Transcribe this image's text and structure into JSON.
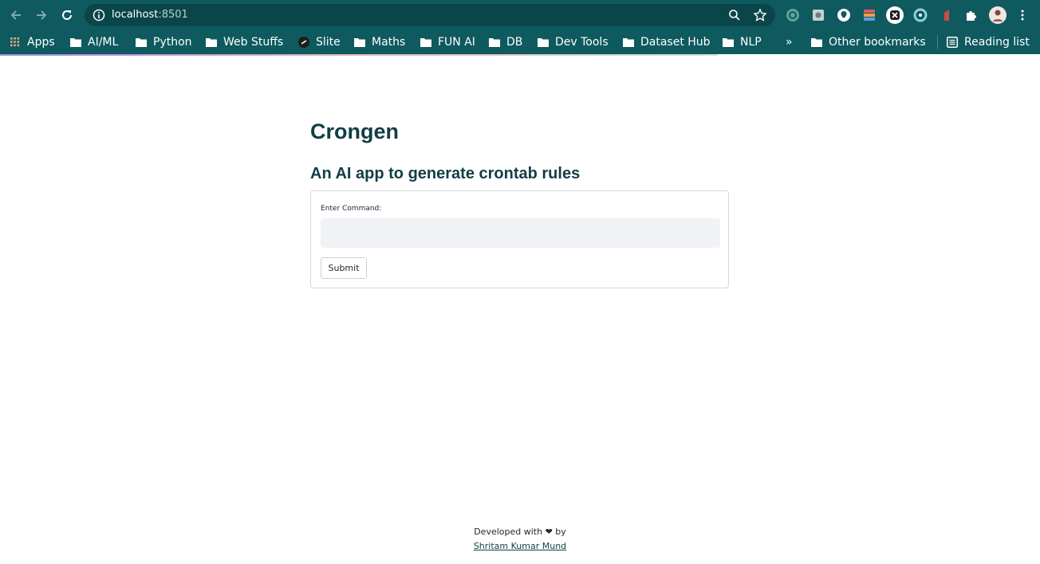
{
  "browser": {
    "url_host": "localhost",
    "url_port": ":8501",
    "back_icon": "arrow-left-icon",
    "forward_icon": "arrow-right-icon",
    "reload_icon": "reload-icon",
    "bookmarks": [
      {
        "label": "Apps",
        "icon": "apps-grid-icon"
      },
      {
        "label": "AI/ML",
        "icon": "folder-icon"
      },
      {
        "label": "Python",
        "icon": "folder-icon"
      },
      {
        "label": "Web Stuffs",
        "icon": "folder-icon"
      },
      {
        "label": "Slite",
        "icon": "slite-icon"
      },
      {
        "label": "Maths",
        "icon": "folder-icon"
      },
      {
        "label": "FUN AI",
        "icon": "folder-icon"
      },
      {
        "label": "DB",
        "icon": "folder-icon"
      },
      {
        "label": "Dev Tools",
        "icon": "folder-icon"
      },
      {
        "label": "Dataset Hub",
        "icon": "folder-icon"
      },
      {
        "label": "NLP",
        "icon": "folder-icon"
      }
    ],
    "overflow_label": "»",
    "other_bookmarks": "Other bookmarks",
    "reading_list": "Reading list",
    "chrome_color": "#0e5a5e"
  },
  "app": {
    "title": "Crongen",
    "subtitle": "An AI app to generate crontab rules",
    "form": {
      "label": "Enter Command:",
      "input_value": "",
      "submit_label": "Submit"
    },
    "footer": {
      "text": "Developed with ❤ by",
      "author": "Shritam Kumar Mund"
    },
    "heading_color": "#123d47",
    "input_bg": "#f0f2f6"
  }
}
